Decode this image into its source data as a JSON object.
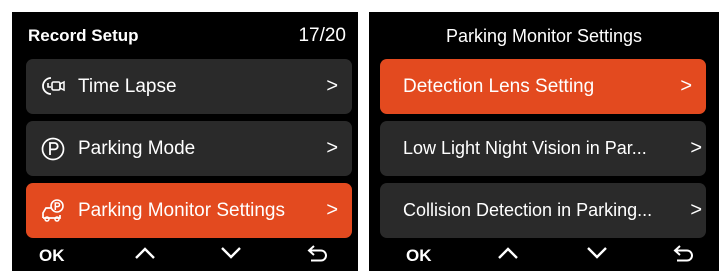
{
  "left_screen": {
    "title": "Record Setup",
    "page_count": "17/20",
    "items": [
      {
        "label": "Time Lapse",
        "icon": "time-lapse-camera-icon",
        "chevron": ">",
        "selected": false
      },
      {
        "label": "Parking Mode",
        "icon": "parking-p-circle-icon",
        "chevron": ">",
        "selected": false
      },
      {
        "label": "Parking Monitor Settings",
        "icon": "parking-car-icon",
        "chevron": ">",
        "selected": true
      }
    ],
    "footer": {
      "ok_label": "OK",
      "up_icon": "chevron-up-icon",
      "down_icon": "chevron-down-icon",
      "back_icon": "back-arrow-icon"
    }
  },
  "right_screen": {
    "title": "Parking Monitor Settings",
    "items": [
      {
        "label": "Detection Lens Setting",
        "chevron": ">",
        "selected": true
      },
      {
        "label": "Low Light Night  Vision in Par...",
        "chevron": ">",
        "selected": false
      },
      {
        "label": "Collision Detection in Parking...",
        "chevron": ">",
        "selected": false
      }
    ],
    "footer": {
      "ok_label": "OK",
      "up_icon": "chevron-up-icon",
      "down_icon": "chevron-down-icon",
      "back_icon": "back-arrow-icon"
    }
  },
  "colors": {
    "selected": "#e34a1f",
    "item_bg": "#2a2a2a",
    "screen_bg": "#000000",
    "text": "#ffffff"
  }
}
